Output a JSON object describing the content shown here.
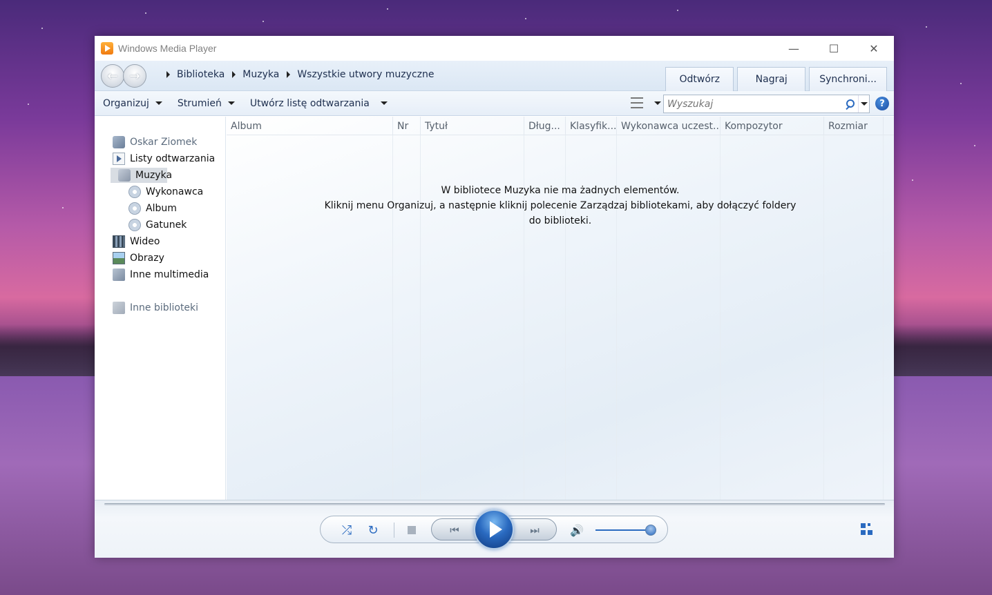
{
  "window": {
    "title": "Windows Media Player"
  },
  "breadcrumb": [
    "Biblioteka",
    "Muzyka",
    "Wszystkie utwory muzyczne"
  ],
  "tabs": [
    "Odtwórz",
    "Nagraj",
    "Synchroni..."
  ],
  "toolbar": {
    "organize": "Organizuj",
    "stream": "Strumień",
    "create_playlist": "Utwórz listę odtwarzania",
    "search_placeholder": "Wyszukaj",
    "help": "?"
  },
  "sidebar": {
    "user": "Oskar Ziomek",
    "playlists": "Listy odtwarzania",
    "music": "Muzyka",
    "artist": "Wykonawca",
    "album": "Album",
    "genre": "Gatunek",
    "video": "Wideo",
    "images": "Obrazy",
    "other_media": "Inne multimedia",
    "other_libraries": "Inne biblioteki"
  },
  "columns": [
    "Album",
    "Nr",
    "Tytuł",
    "Dług...",
    "Klasyfik...",
    "Wykonawca uczest...",
    "Kompozytor",
    "Rozmiar"
  ],
  "empty_message": {
    "line1": "W bibliotece Muzyka nie ma żadnych elementów.",
    "line2": "Kliknij menu Organizuj, a następnie kliknij polecenie Zarządzaj bibliotekami, aby dołączyć foldery do biblioteki."
  },
  "player": {
    "volume_fraction": 1.0
  },
  "colors": {
    "accent": "#2a6ac0",
    "nav_background": "#dbe7f4"
  }
}
